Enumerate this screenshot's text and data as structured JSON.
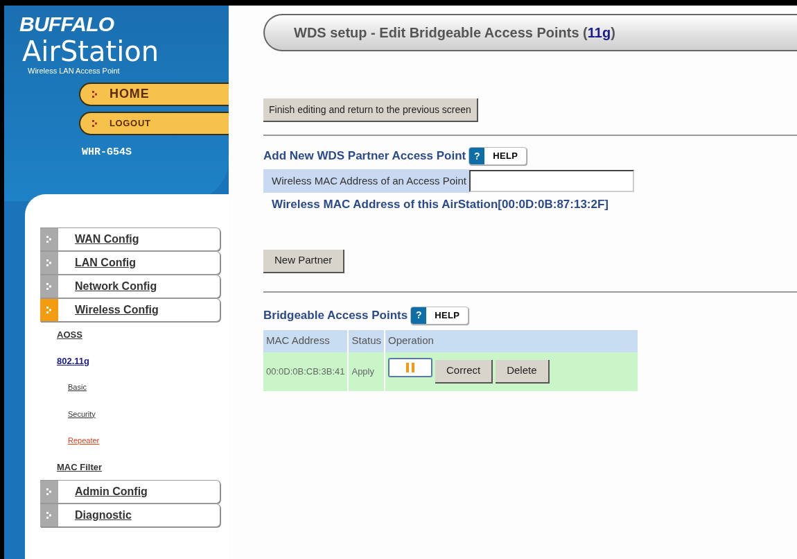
{
  "brand": {
    "logo": "BUFFALO",
    "product": "AirStation",
    "tagline": "Wireless LAN Access Point",
    "model": "WHR-G54S"
  },
  "top_buttons": [
    {
      "label": "HOME",
      "kind": "large"
    },
    {
      "label": "LOGOUT",
      "kind": "small"
    }
  ],
  "sidebar": {
    "items": [
      {
        "label": "WAN Config",
        "selected": false
      },
      {
        "label": "LAN Config",
        "selected": false
      },
      {
        "label": "Network Config",
        "selected": false
      },
      {
        "label": "Wireless Config",
        "selected": true,
        "children": [
          {
            "label": "AOSS",
            "selected": false
          },
          {
            "label": "802.11g",
            "selected": true,
            "children": [
              {
                "label": "Basic",
                "selected": false
              },
              {
                "label": "Security",
                "selected": false
              },
              {
                "label": "Repeater",
                "selected": true
              }
            ]
          },
          {
            "label": "MAC Filter",
            "selected": false
          }
        ]
      },
      {
        "label": "Admin Config",
        "selected": false
      },
      {
        "label": "Diagnostic",
        "selected": false
      }
    ]
  },
  "page_title": {
    "prefix": "WDS setup - Edit Bridgeable Access Points (",
    "highlight": "11g",
    "suffix": ")"
  },
  "finish_button": "Finish editing and return to the previous screen",
  "add_section": {
    "heading": "Add New WDS Partner Access Point",
    "help": "HELP",
    "help_mark": "?",
    "field_label": "Wireless MAC Address of an Access Point",
    "own_mac": "Wireless MAC Address of this AirStation[00:0D:0B:87:13:2F]",
    "button": "New Partner"
  },
  "bridge_section": {
    "heading": "Bridgeable Access Points",
    "help": "HELP",
    "help_mark": "?",
    "table": {
      "columns": [
        "MAC Address",
        "Status",
        "Operation"
      ],
      "rows": [
        {
          "mac": "00:0D:0B:CB:3B:41",
          "status": "Apply",
          "actions": [
            "Correct",
            "Delete"
          ]
        }
      ]
    }
  }
}
